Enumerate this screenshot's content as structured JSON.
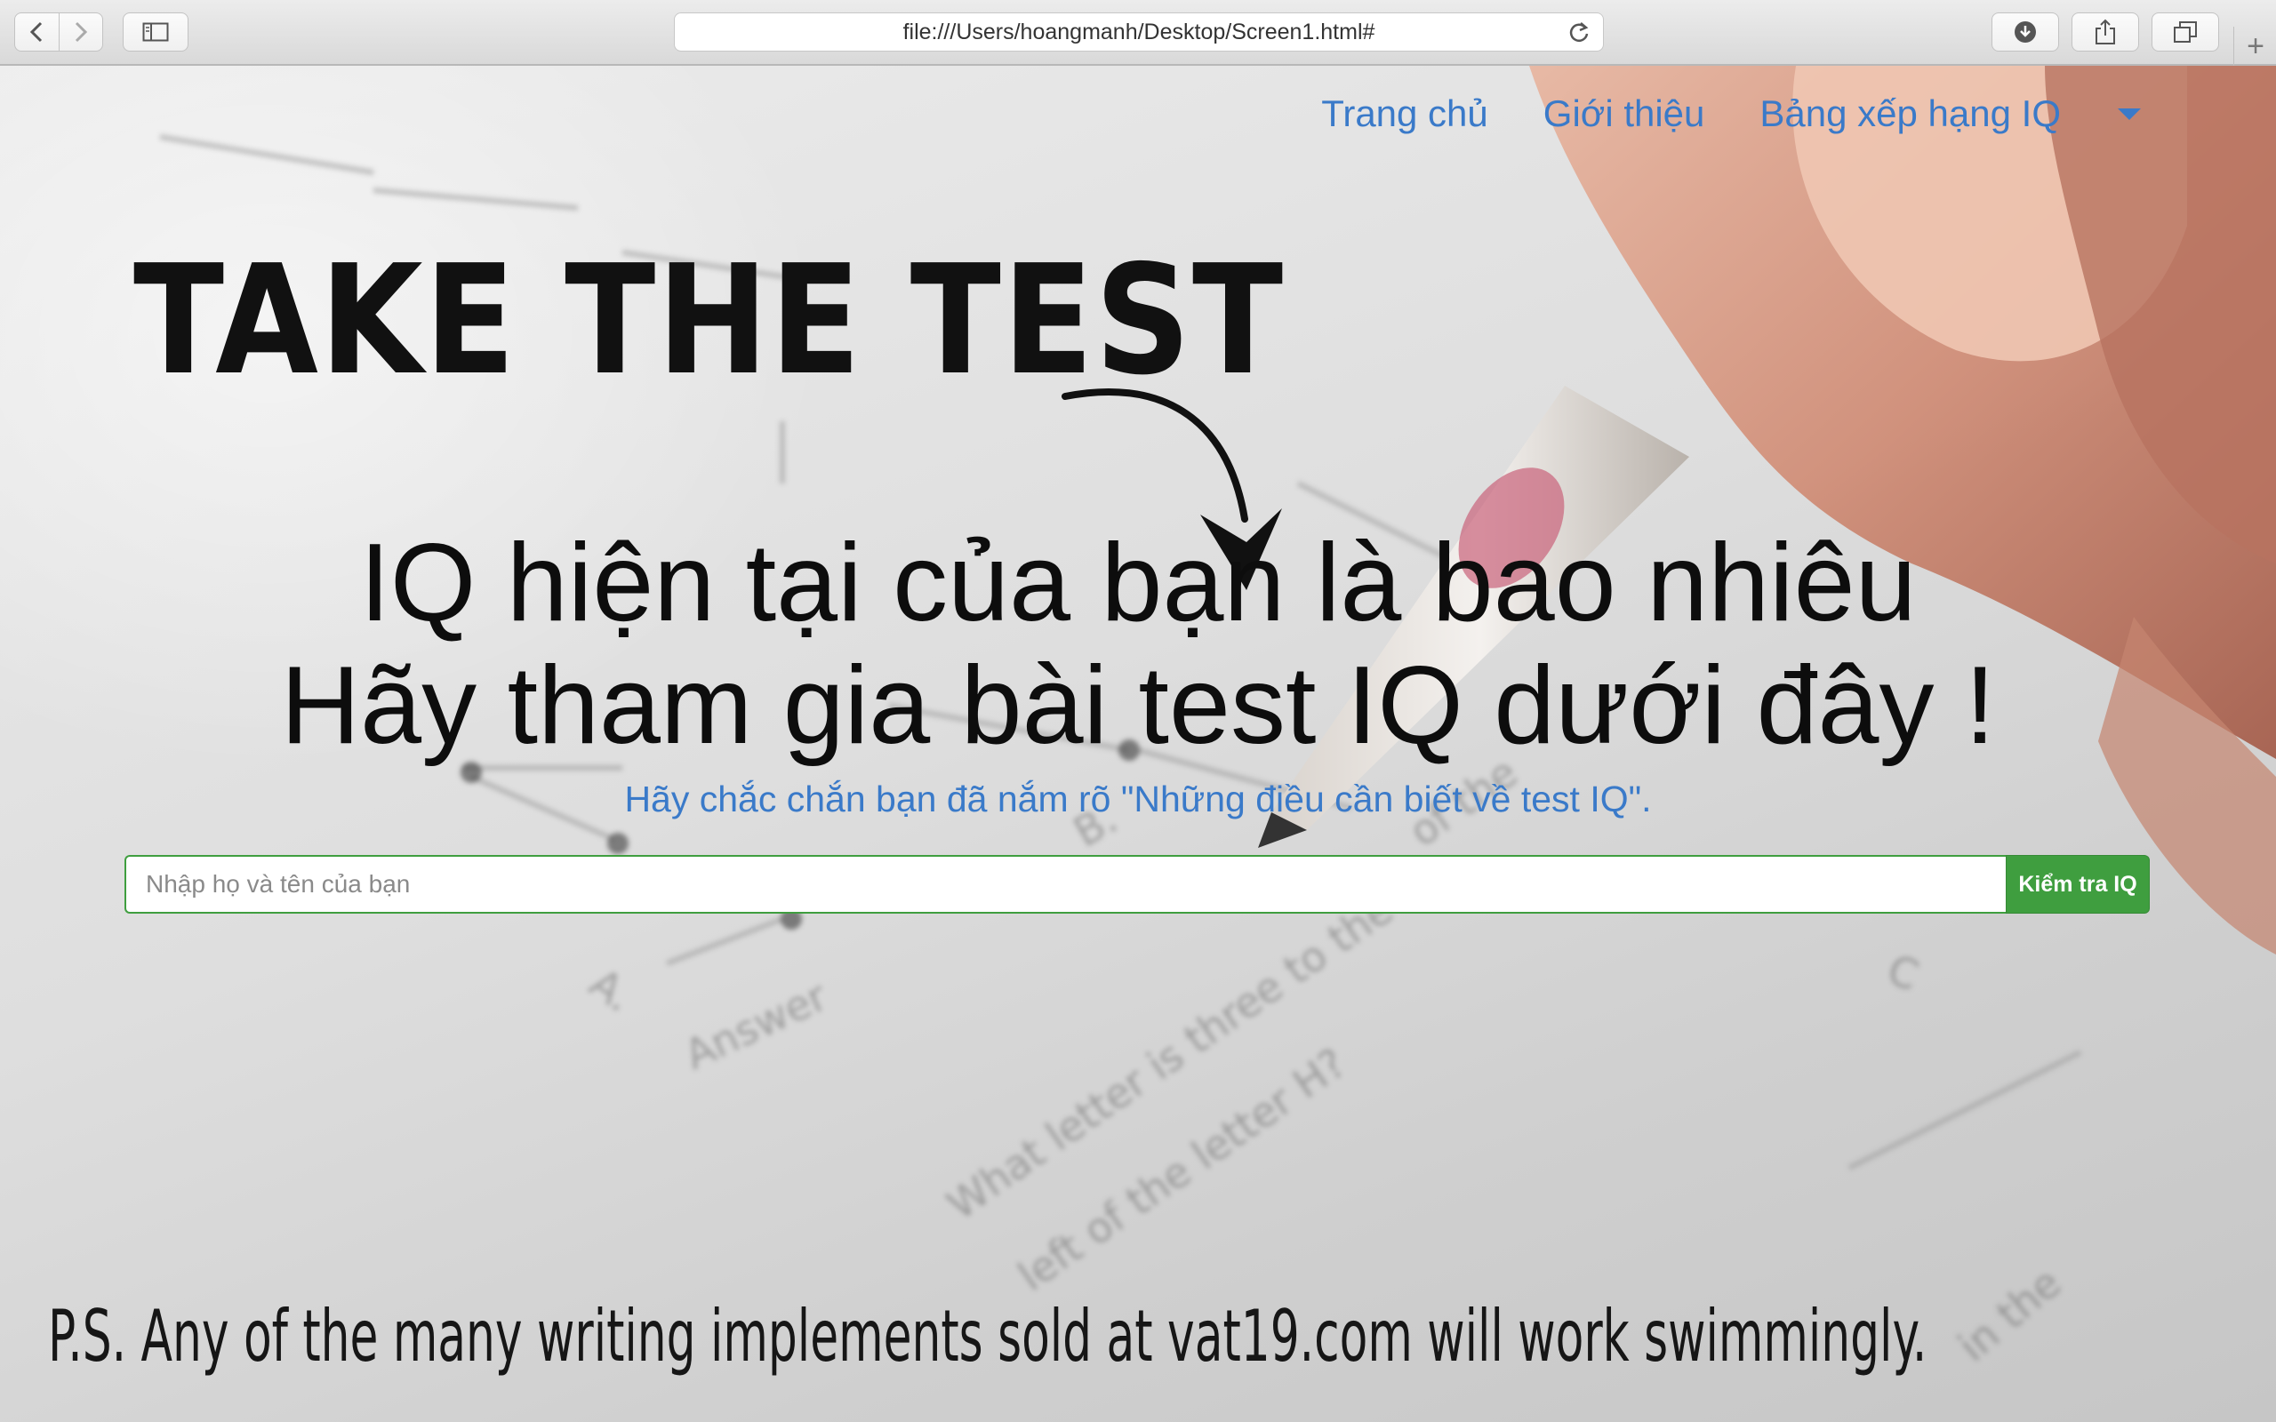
{
  "browser": {
    "url": "file:///Users/hoangmanh/Desktop/Screen1.html#",
    "icons": [
      "back-icon",
      "forward-icon",
      "sidebar-icon",
      "reload-icon",
      "download-icon",
      "share-icon",
      "tabs-icon",
      "plus-icon"
    ],
    "new_tab_glyph": "+"
  },
  "nav": {
    "items": [
      "Trang chủ",
      "Giới thiệu",
      "Bảng xếp hạng IQ"
    ]
  },
  "hero": {
    "image_text": "TAKE THE TEST",
    "headline_line1": "IQ hiện tại của bạn là bao nhiêu",
    "headline_line2": "Hãy tham gia bài test IQ dưới đây !",
    "subline": "Hãy chắc chắn bạn đã nắm rõ  \"Những điều cần biết về test IQ\"."
  },
  "form": {
    "name_placeholder": "Nhập họ và tên của bạn",
    "name_value": "",
    "submit_label": "Kiểm tra IQ",
    "accent_color": "#3f9e3f"
  },
  "footer": {
    "ps_text": "P.S. Any of the many writing implements sold at vat19.com will work swimmingly."
  },
  "colors": {
    "link": "#3a7ac9",
    "headline": "#0d0d0d"
  }
}
